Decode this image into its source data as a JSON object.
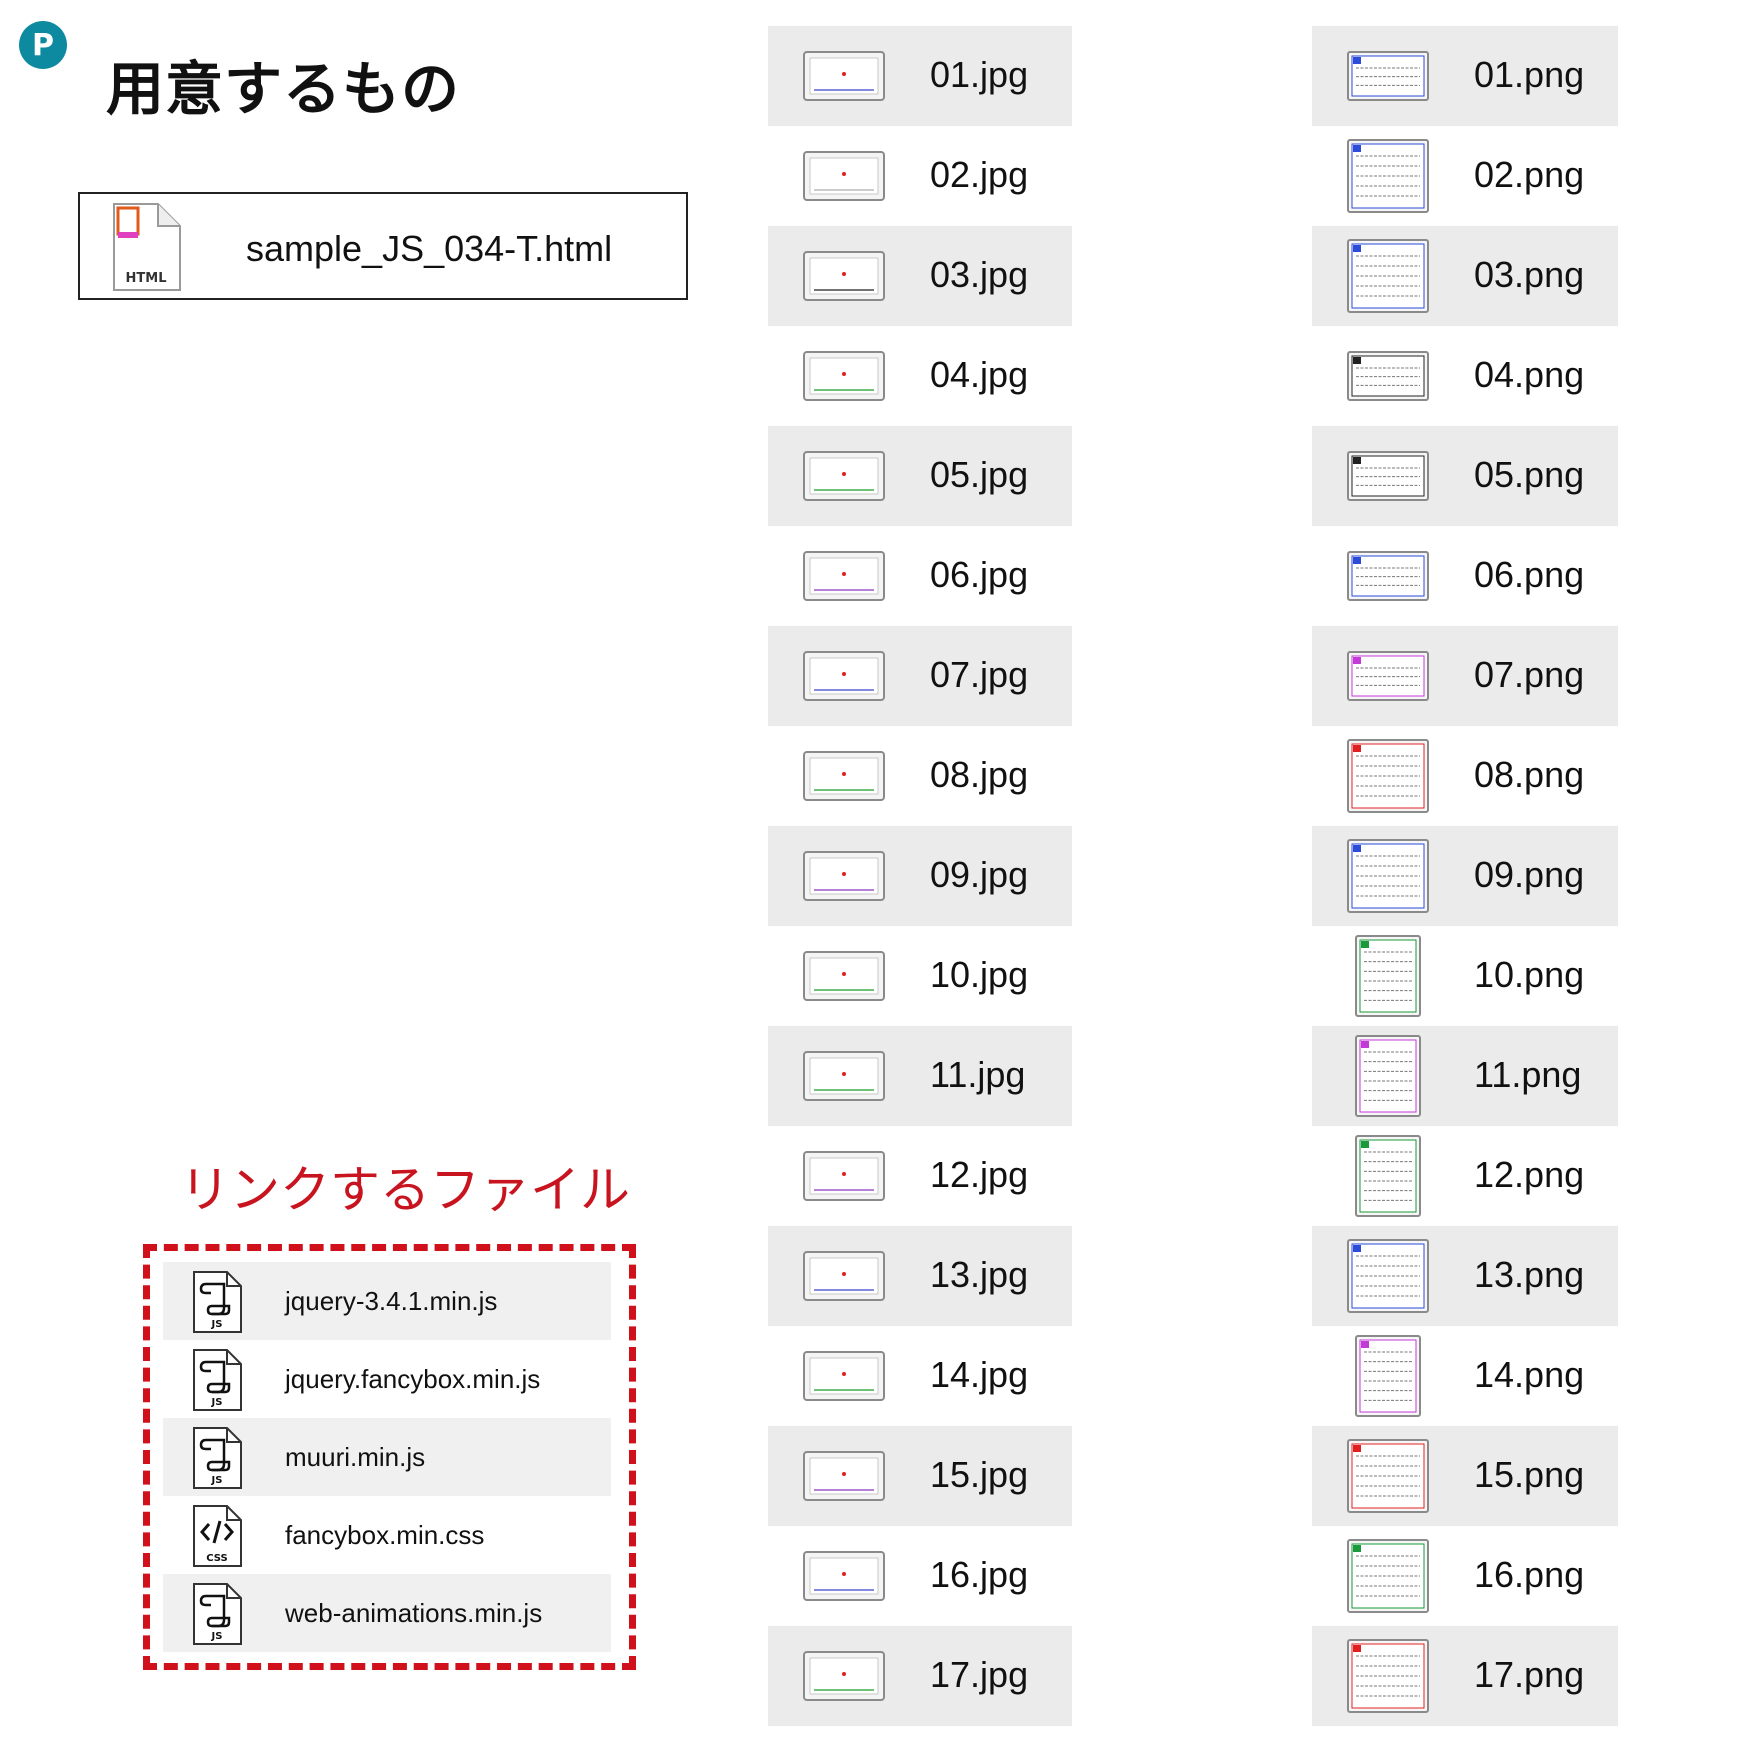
{
  "badge": {
    "letter": "P",
    "color": "#0e8aa0"
  },
  "title": "用意するもの",
  "main_file": {
    "name": "sample_JS_034-T.html",
    "icon": "html-file-icon",
    "icon_label": "HTML"
  },
  "link_section": {
    "title": "リンクするファイル",
    "accent_color": "#d0111b",
    "files": [
      {
        "name": "jquery-3.4.1.min.js",
        "icon": "js-script-file-icon",
        "icon_label": "JS"
      },
      {
        "name": "jquery.fancybox.min.js",
        "icon": "js-script-file-icon",
        "icon_label": "JS"
      },
      {
        "name": "muuri.min.js",
        "icon": "js-script-file-icon",
        "icon_label": "JS"
      },
      {
        "name": "fancybox.min.css",
        "icon": "css-code-file-icon",
        "icon_label": "CSS"
      },
      {
        "name": "web-animations.min.js",
        "icon": "js-script-file-icon",
        "icon_label": "JS"
      }
    ]
  },
  "jpg_files": [
    {
      "name": "01.jpg",
      "line": "#5b63d8"
    },
    {
      "name": "02.jpg",
      "line": "#bbbbbb"
    },
    {
      "name": "03.jpg",
      "line": "#444444"
    },
    {
      "name": "04.jpg",
      "line": "#3fae4a"
    },
    {
      "name": "05.jpg",
      "line": "#3fae4a"
    },
    {
      "name": "06.jpg",
      "line": "#9b59c9"
    },
    {
      "name": "07.jpg",
      "line": "#5b63d8"
    },
    {
      "name": "08.jpg",
      "line": "#3fae4a"
    },
    {
      "name": "09.jpg",
      "line": "#9b59c9"
    },
    {
      "name": "10.jpg",
      "line": "#3fae4a"
    },
    {
      "name": "11.jpg",
      "line": "#3fae4a"
    },
    {
      "name": "12.jpg",
      "line": "#9b59c9"
    },
    {
      "name": "13.jpg",
      "line": "#5b63d8"
    },
    {
      "name": "14.jpg",
      "line": "#3fae4a"
    },
    {
      "name": "15.jpg",
      "line": "#9b59c9"
    },
    {
      "name": "16.jpg",
      "line": "#5b63d8"
    },
    {
      "name": "17.jpg",
      "line": "#3fae4a"
    }
  ],
  "png_files": [
    {
      "name": "01.png",
      "accent": "#2b4bd8",
      "portrait": false
    },
    {
      "name": "02.png",
      "accent": "#2b4bd8",
      "portrait": false
    },
    {
      "name": "03.png",
      "accent": "#2b4bd8",
      "portrait": false
    },
    {
      "name": "04.png",
      "accent": "#222222",
      "portrait": false
    },
    {
      "name": "05.png",
      "accent": "#222222",
      "portrait": false
    },
    {
      "name": "06.png",
      "accent": "#2b4bd8",
      "portrait": false
    },
    {
      "name": "07.png",
      "accent": "#c23bd6",
      "portrait": false
    },
    {
      "name": "08.png",
      "accent": "#e02020",
      "portrait": false
    },
    {
      "name": "09.png",
      "accent": "#2b4bd8",
      "portrait": false
    },
    {
      "name": "10.png",
      "accent": "#1a9a3a",
      "portrait": true
    },
    {
      "name": "11.png",
      "accent": "#c23bd6",
      "portrait": true
    },
    {
      "name": "12.png",
      "accent": "#1a9a3a",
      "portrait": true
    },
    {
      "name": "13.png",
      "accent": "#2b4bd8",
      "portrait": false
    },
    {
      "name": "14.png",
      "accent": "#c23bd6",
      "portrait": true
    },
    {
      "name": "15.png",
      "accent": "#e02020",
      "portrait": false
    },
    {
      "name": "16.png",
      "accent": "#1a9a3a",
      "portrait": false
    },
    {
      "name": "17.png",
      "accent": "#e02020",
      "portrait": false
    }
  ]
}
